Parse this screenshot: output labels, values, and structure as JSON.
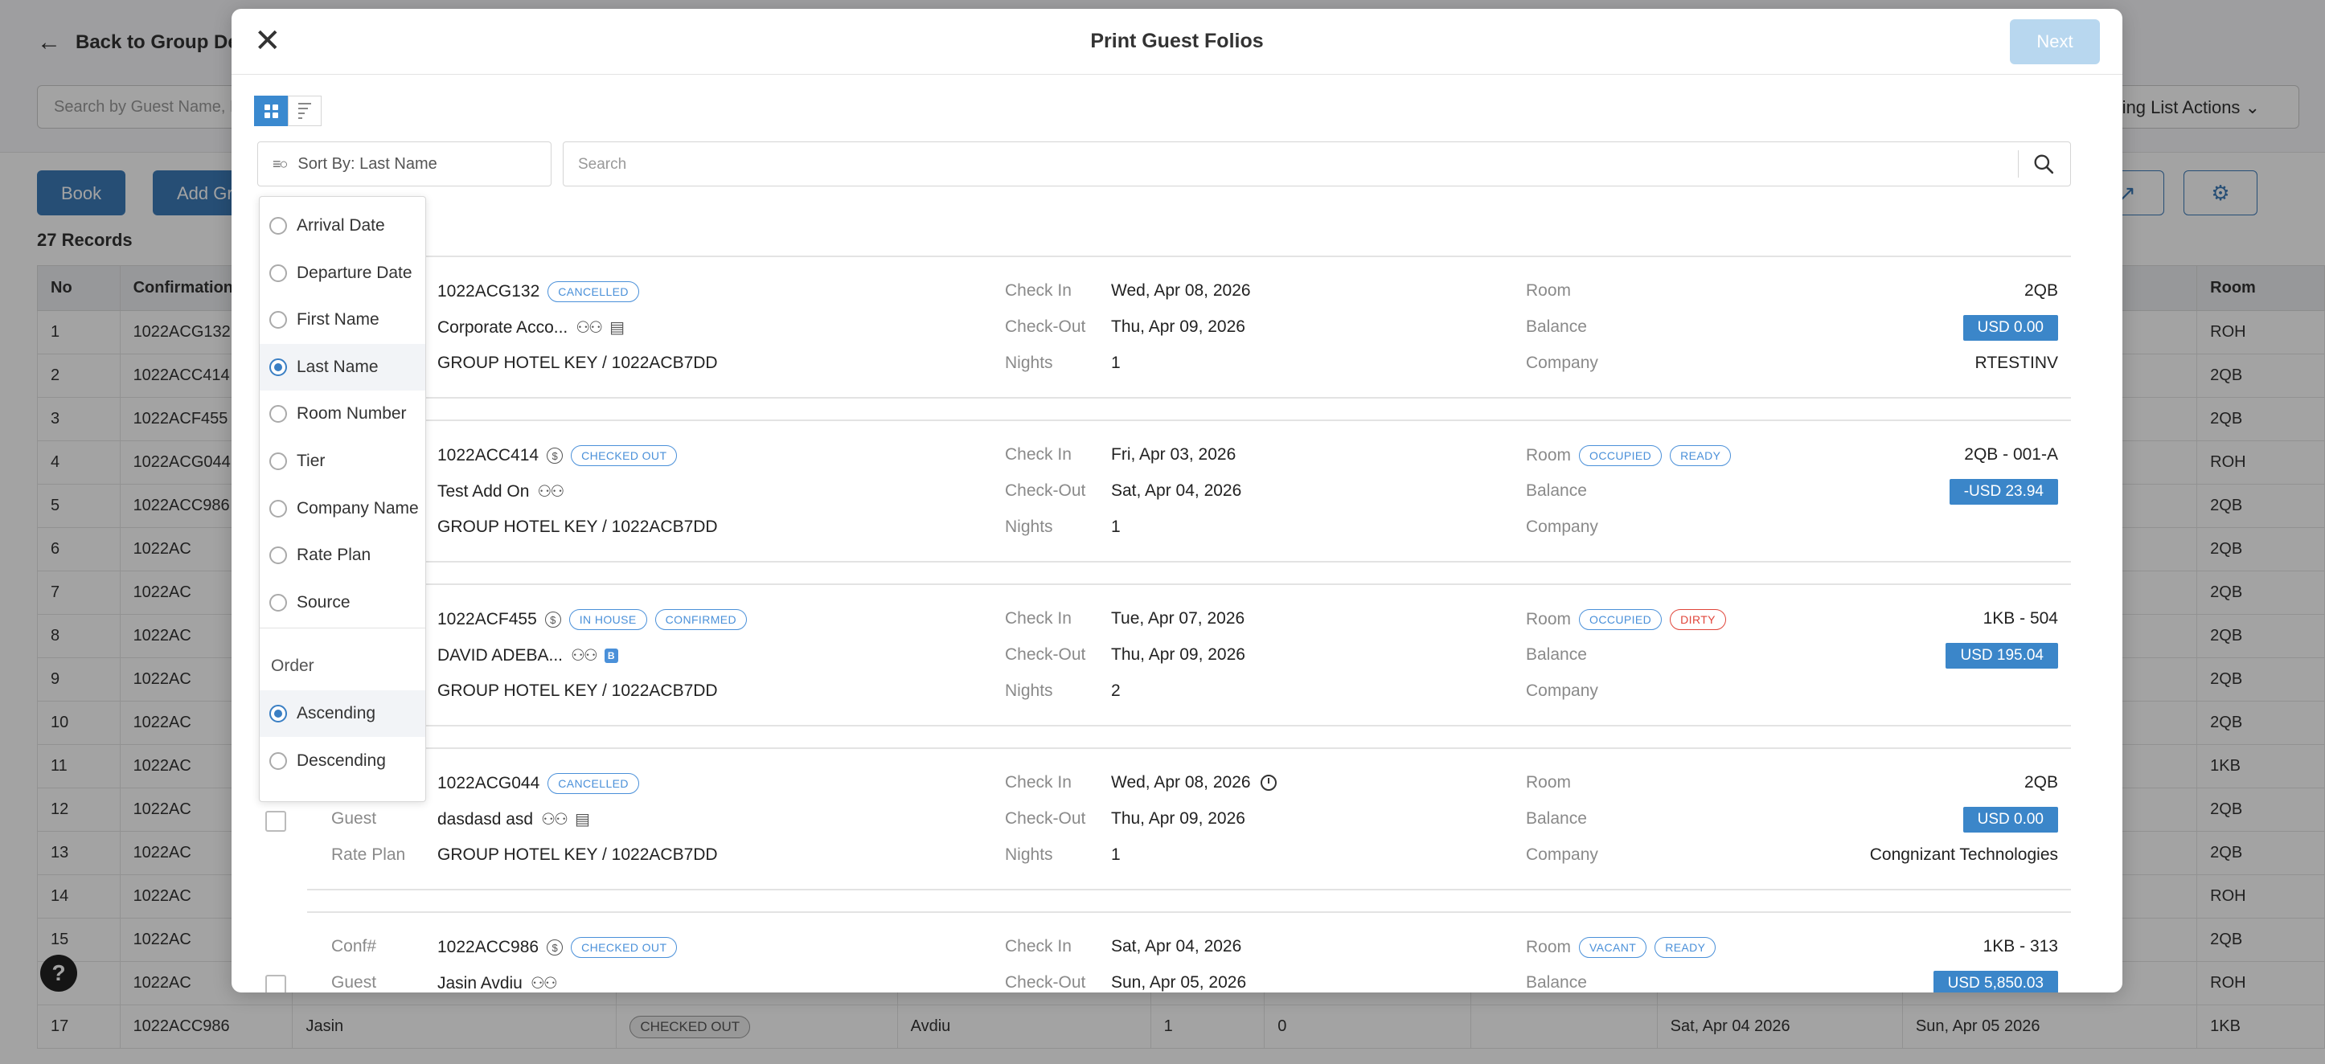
{
  "background": {
    "back_label": "Back to Group Details",
    "search_placeholder": "Search by Guest Name, Room",
    "rooming_actions": "Rooming List Actions",
    "book_btn": "Book",
    "add_btn": "Add Group",
    "records": "27 Records",
    "columns": [
      "No",
      "Confirmation",
      "",
      "",
      "",
      "",
      "",
      "",
      "",
      "",
      "Room"
    ],
    "rows": [
      {
        "no": "1",
        "conf": "1022ACG132",
        "room": "ROH"
      },
      {
        "no": "2",
        "conf": "1022ACC414",
        "room": "2QB"
      },
      {
        "no": "3",
        "conf": "1022ACF455",
        "room": "2QB"
      },
      {
        "no": "4",
        "conf": "1022ACG044",
        "room": "ROH"
      },
      {
        "no": "5",
        "conf": "1022ACC986",
        "room": "2QB"
      },
      {
        "no": "6",
        "conf": "1022AC",
        "room": "2QB"
      },
      {
        "no": "7",
        "conf": "1022AC",
        "room": "2QB"
      },
      {
        "no": "8",
        "conf": "1022AC",
        "room": "2QB"
      },
      {
        "no": "9",
        "conf": "1022AC",
        "room": "2QB"
      },
      {
        "no": "10",
        "conf": "1022AC",
        "room": "2QB"
      },
      {
        "no": "11",
        "conf": "1022AC",
        "room": "1KB"
      },
      {
        "no": "12",
        "conf": "1022AC",
        "room": "2QB"
      },
      {
        "no": "13",
        "conf": "1022AC",
        "room": "2QB"
      },
      {
        "no": "14",
        "conf": "1022AC",
        "room": "ROH"
      },
      {
        "no": "15",
        "conf": "1022AC",
        "room": "2QB"
      },
      {
        "no": "16",
        "conf": "1022AC",
        "room": "ROH"
      }
    ],
    "date_suffix": "2026",
    "last_row": {
      "no": "17",
      "conf": "1022ACC986",
      "first": "Jasin",
      "status": "CHECKED OUT",
      "last": "Avdiu",
      "n1": "1",
      "n2": "0",
      "arr": "Sat, Apr 04 2026",
      "dep": "Sun, Apr 05 2026",
      "room": "1KB"
    }
  },
  "modal": {
    "title": "Print Guest Folios",
    "next_label": "Next",
    "sort_label": "Sort By: Last Name",
    "search_placeholder": "Search"
  },
  "sort_menu": {
    "options": [
      "Arrival Date",
      "Departure Date",
      "First Name",
      "Last Name",
      "Room Number",
      "Tier",
      "Company Name",
      "Rate Plan",
      "Source"
    ],
    "selected": "Last Name",
    "order_label": "Order",
    "order_options": [
      "Ascending",
      "Descending"
    ],
    "order_selected": "Ascending"
  },
  "labels": {
    "conf": "Conf#",
    "guest": "Guest",
    "rate_plan": "Rate Plan",
    "check_in": "Check In",
    "check_out": "Check-Out",
    "nights": "Nights",
    "room": "Room",
    "balance": "Balance",
    "company": "Company"
  },
  "cards": [
    {
      "conf": "1022ACG132",
      "status_tags": [
        "CANCELLED"
      ],
      "guest": "Corporate Acco...",
      "rate_plan": "GROUP HOTEL KEY / 1022ACB7DD",
      "check_in": "Wed, Apr 08, 2026",
      "check_out": "Thu, Apr 09, 2026",
      "nights": "1",
      "room_tags": [],
      "room": "2QB",
      "balance": "USD 0.00",
      "company": "RTESTINV"
    },
    {
      "conf": "1022ACC414",
      "status_tags": [
        "CHECKED OUT"
      ],
      "guest": "Test Add On",
      "rate_plan": "GROUP HOTEL KEY / 1022ACB7DD",
      "check_in": "Fri, Apr 03, 2026",
      "check_out": "Sat, Apr 04, 2026",
      "nights": "1",
      "room_tags": [
        "OCCUPIED",
        "READY"
      ],
      "room": "2QB - 001-A",
      "balance": "-USD 23.94",
      "company": ""
    },
    {
      "conf": "1022ACF455",
      "status_tags": [
        "IN HOUSE",
        "CONFIRMED"
      ],
      "guest": "DAVID ADEBA...",
      "rate_plan": "GROUP HOTEL KEY / 1022ACB7DD",
      "check_in": "Tue, Apr 07, 2026",
      "check_out": "Thu, Apr 09, 2026",
      "nights": "2",
      "room_tags": [
        "OCCUPIED",
        "DIRTY"
      ],
      "room": "1KB - 504",
      "balance": "USD 195.04",
      "company": ""
    },
    {
      "conf": "1022ACG044",
      "status_tags": [
        "CANCELLED"
      ],
      "guest": "dasdasd asd",
      "rate_plan": "GROUP HOTEL KEY / 1022ACB7DD",
      "check_in": "Wed, Apr 08, 2026",
      "check_out": "Thu, Apr 09, 2026",
      "nights": "1",
      "room_tags": [],
      "room": "2QB",
      "balance": "USD 0.00",
      "company": "Congnizant Technologies"
    },
    {
      "conf": "1022ACC986",
      "status_tags": [
        "CHECKED OUT"
      ],
      "guest": "Jasin Avdiu",
      "rate_plan": "",
      "check_in": "Sat, Apr 04, 2026",
      "check_out": "Sun, Apr 05, 2026",
      "nights": "",
      "room_tags": [
        "VACANT",
        "READY"
      ],
      "room": "1KB - 313",
      "balance": "USD 5,850.03",
      "company": ""
    }
  ]
}
